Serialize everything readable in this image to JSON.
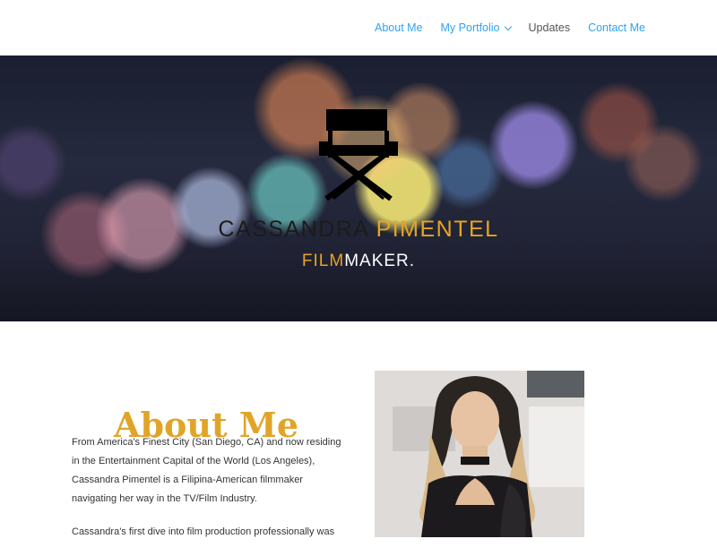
{
  "nav": {
    "items": [
      {
        "label": "About Me"
      },
      {
        "label": "My Portfolio"
      },
      {
        "label": "Updates"
      },
      {
        "label": "Contact Me"
      }
    ]
  },
  "hero": {
    "title_part1": "CASSANDRA",
    "title_part2": "PIMENTEL",
    "subtitle_part1": "FILM",
    "subtitle_part2": "MAKER."
  },
  "about": {
    "heading": "About Me",
    "paragraph1": "From America's Finest City (San Diego, CA) and now residing in the Entertainment Capital of the World (Los Angeles), Cassandra Pimentel is a Filipina-American filmmaker navigating her way in the TV/Film Industry.",
    "paragraph2": "Cassandra's first dive into film production professionally was"
  },
  "icons": {
    "hero_icon": "director-chair-icon",
    "dropdown_icon": "chevron-down-icon"
  },
  "colors": {
    "link": "#2ea3f2",
    "accent": "#e6a520",
    "text": "#333333"
  }
}
